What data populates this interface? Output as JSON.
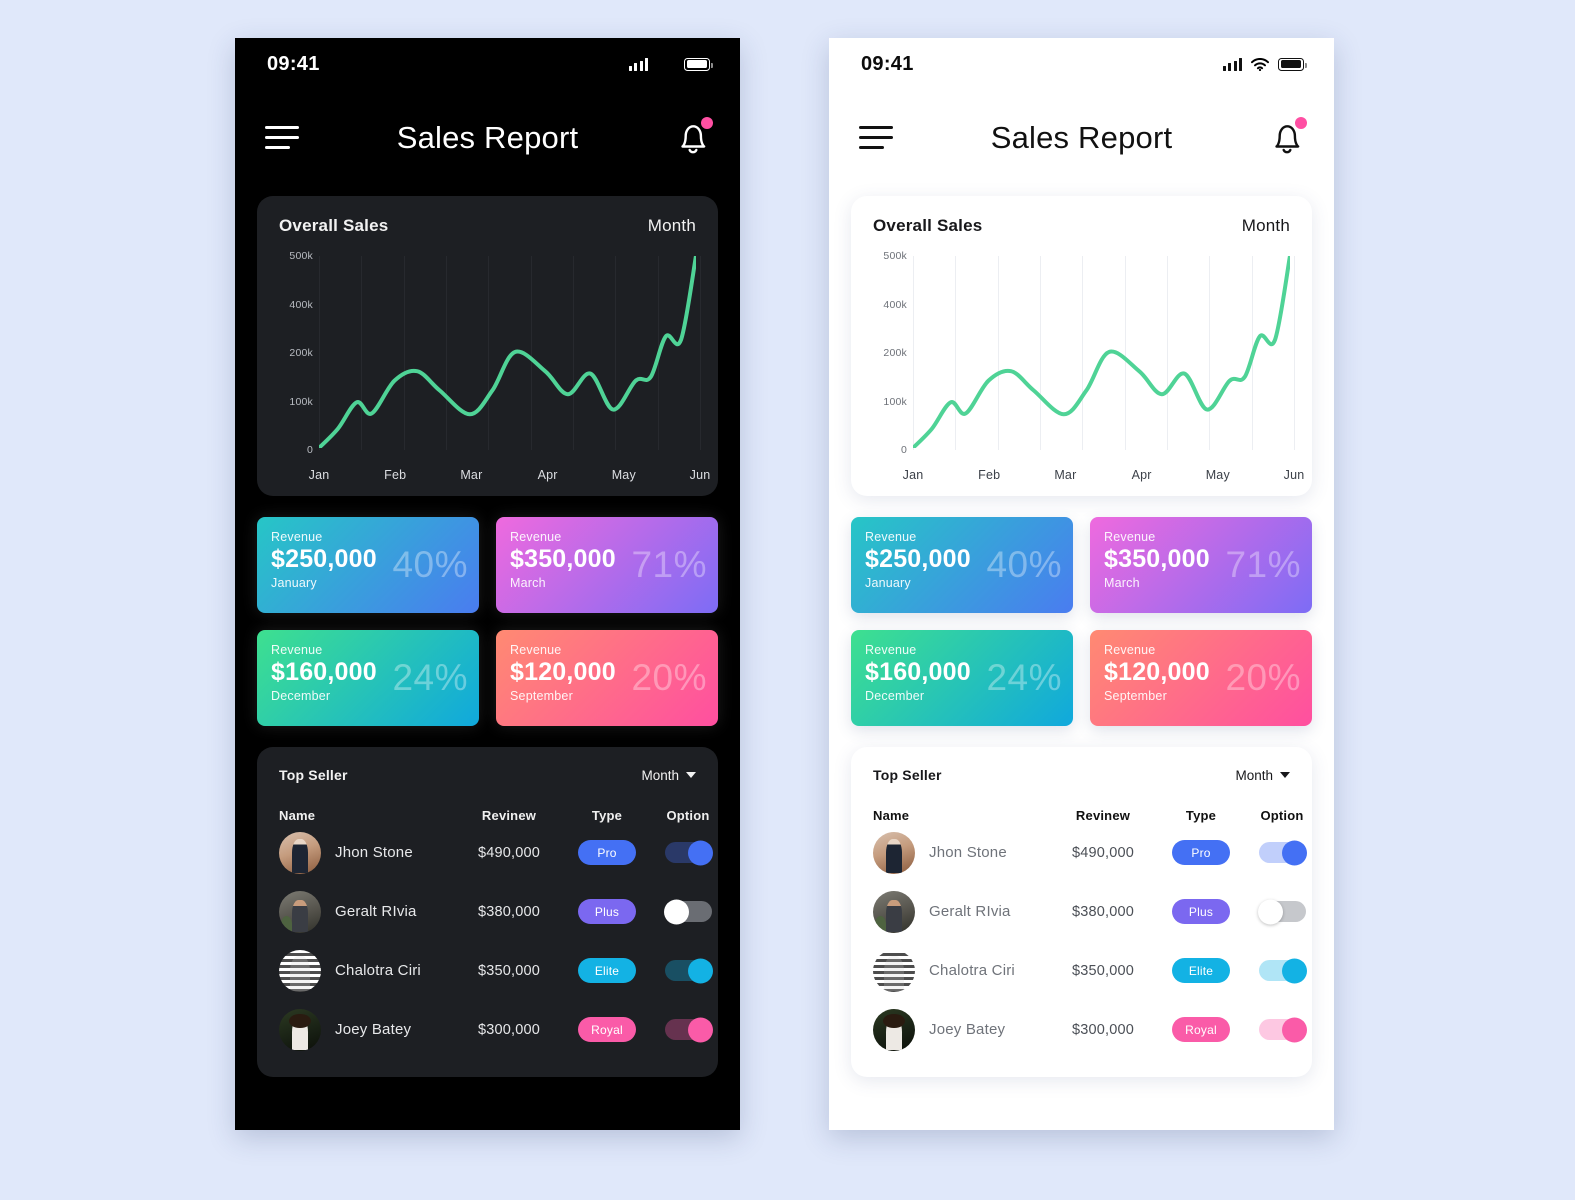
{
  "theme_colors": {
    "page_background": "#e0e8fa",
    "dark_phone_bg": "#000000",
    "dark_card_bg": "#1d1f23",
    "light_phone_bg": "#ffffff",
    "light_card_bg": "#ffffff",
    "chart_line": "#4fd396",
    "notification_dot": "#ff4fa3"
  },
  "status_bar": {
    "time": "09:41",
    "signal_icon": "signal-bars-icon",
    "wifi_icon": "wifi-icon",
    "battery_icon": "battery-icon"
  },
  "app_bar": {
    "title": "Sales Report",
    "menu_icon": "hamburger-menu-icon",
    "notification_icon": "bell-icon",
    "has_notification_badge": true
  },
  "chart_card": {
    "title": "Overall Sales",
    "period": "Month"
  },
  "chart_data": {
    "type": "line",
    "title": "Overall Sales",
    "xlabel": "",
    "ylabel": "",
    "grid": "vertical-only",
    "legend": "none",
    "line_color": "#4fd396",
    "tick_labels_y": [
      "500k",
      "400k",
      "200k",
      "100k",
      "0"
    ],
    "tick_values_y": [
      500000,
      400000,
      200000,
      100000,
      0
    ],
    "categories": [
      "Jan",
      "Feb",
      "Mar",
      "Apr",
      "May",
      "Jun"
    ],
    "x": [
      0.0,
      0.05,
      0.1,
      0.14,
      0.2,
      0.26,
      0.32,
      0.4,
      0.46,
      0.52,
      0.6,
      0.66,
      0.72,
      0.78,
      0.84,
      0.88,
      0.92,
      0.96,
      1.0
    ],
    "values": [
      0,
      40000,
      95000,
      72000,
      140000,
      160000,
      120000,
      70000,
      120000,
      200000,
      160000,
      112000,
      155000,
      80000,
      140000,
      148000,
      265000,
      250000,
      500000
    ],
    "ylim": [
      0,
      500000
    ]
  },
  "revenue_cards": [
    {
      "label": "Revenue",
      "amount": "$250,000",
      "month": "January",
      "percent": "40%",
      "gradient_from": "#26c6c6",
      "gradient_to": "#4a7cf0"
    },
    {
      "label": "Revenue",
      "amount": "$350,000",
      "month": "March",
      "percent": "71%",
      "gradient_from": "#ef6ade",
      "gradient_to": "#7d6cf5"
    },
    {
      "label": "Revenue",
      "amount": "$160,000",
      "month": "December",
      "percent": "24%",
      "gradient_from": "#3ee08f",
      "gradient_to": "#10a8dd"
    },
    {
      "label": "Revenue",
      "amount": "$120,000",
      "month": "September",
      "percent": "20%",
      "gradient_from": "#ff8a72",
      "gradient_to": "#ff4fa0"
    }
  ],
  "top_seller": {
    "title": "Top Seller",
    "period": "Month",
    "columns": [
      "Name",
      "Revinew",
      "Type",
      "Option"
    ],
    "rows": [
      {
        "name": "Jhon Stone",
        "revenue": "$490,000",
        "type": "Pro",
        "type_color": "#4470f4",
        "toggle_on": true,
        "avatar": "avatar-jhon-stone"
      },
      {
        "name": "Geralt RIvia",
        "revenue": "$380,000",
        "type": "Plus",
        "type_color": "#7b68f0",
        "toggle_on": false,
        "avatar": "avatar-geralt-rivia"
      },
      {
        "name": "Chalotra Ciri",
        "revenue": "$350,000",
        "type": "Elite",
        "type_color": "#13b2e4",
        "toggle_on": true,
        "avatar": "avatar-chalotra-ciri"
      },
      {
        "name": "Joey Batey",
        "revenue": "$300,000",
        "type": "Royal",
        "type_color": "#fa5ba8",
        "toggle_on": true,
        "avatar": "avatar-joey-batey"
      }
    ]
  }
}
